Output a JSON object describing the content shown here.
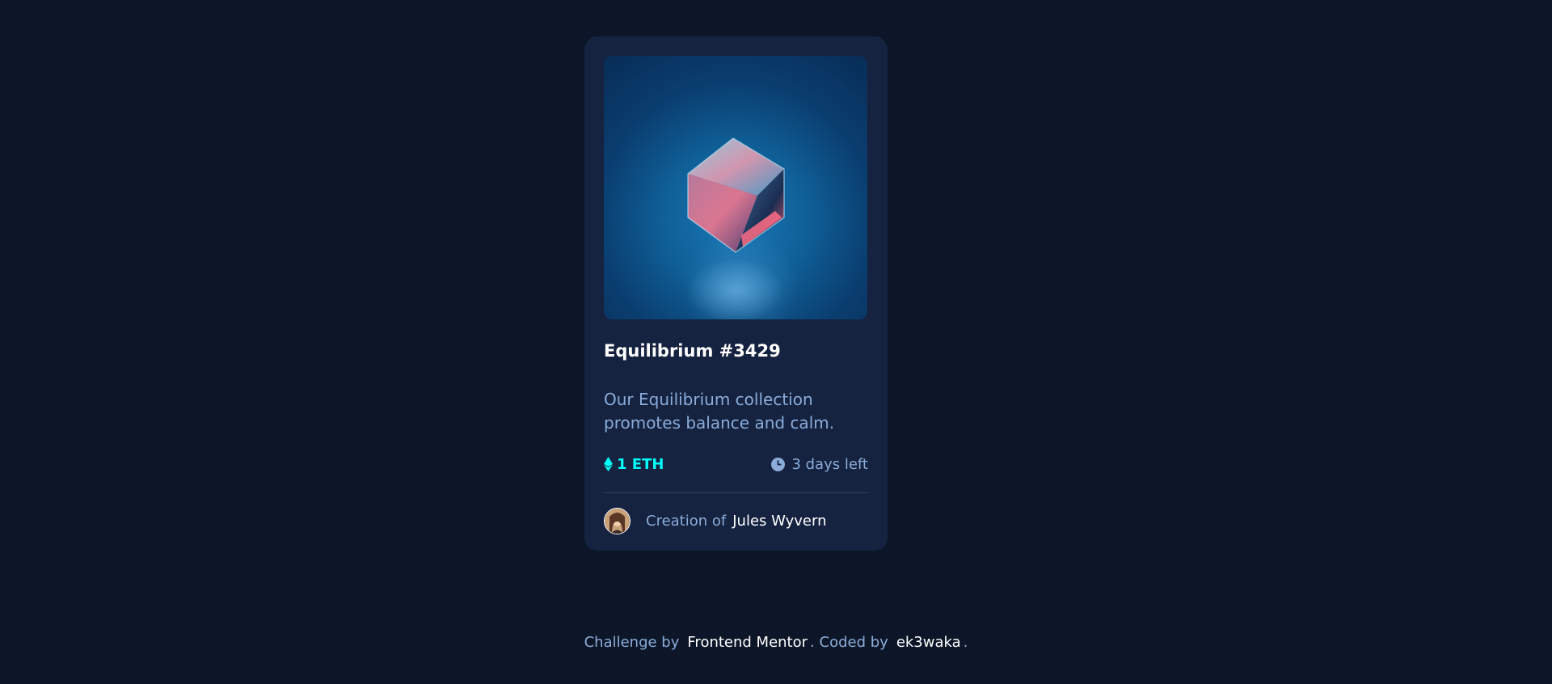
{
  "card": {
    "title": "Equilibrium #3429",
    "description": "Our Equilibrium collection promotes balance and calm.",
    "price": "1 ETH",
    "time_left": "3 days left",
    "creator_label": "Creation of",
    "creator_name": "Jules Wyvern"
  },
  "footer": {
    "prefix": "Challenge by",
    "challenge_link": "Frontend Mentor",
    "dot1": ".",
    "coded_by": "Coded by",
    "author_link": "ek3waka",
    "dot2": "."
  },
  "colors": {
    "background": "#0d1628",
    "card": "#152340",
    "accent_cyan": "#00fff8",
    "muted_blue": "#8bacd9",
    "white": "#ffffff"
  },
  "icons": {
    "eth": "ethereum-icon",
    "clock": "clock-icon",
    "avatar": "avatar"
  }
}
